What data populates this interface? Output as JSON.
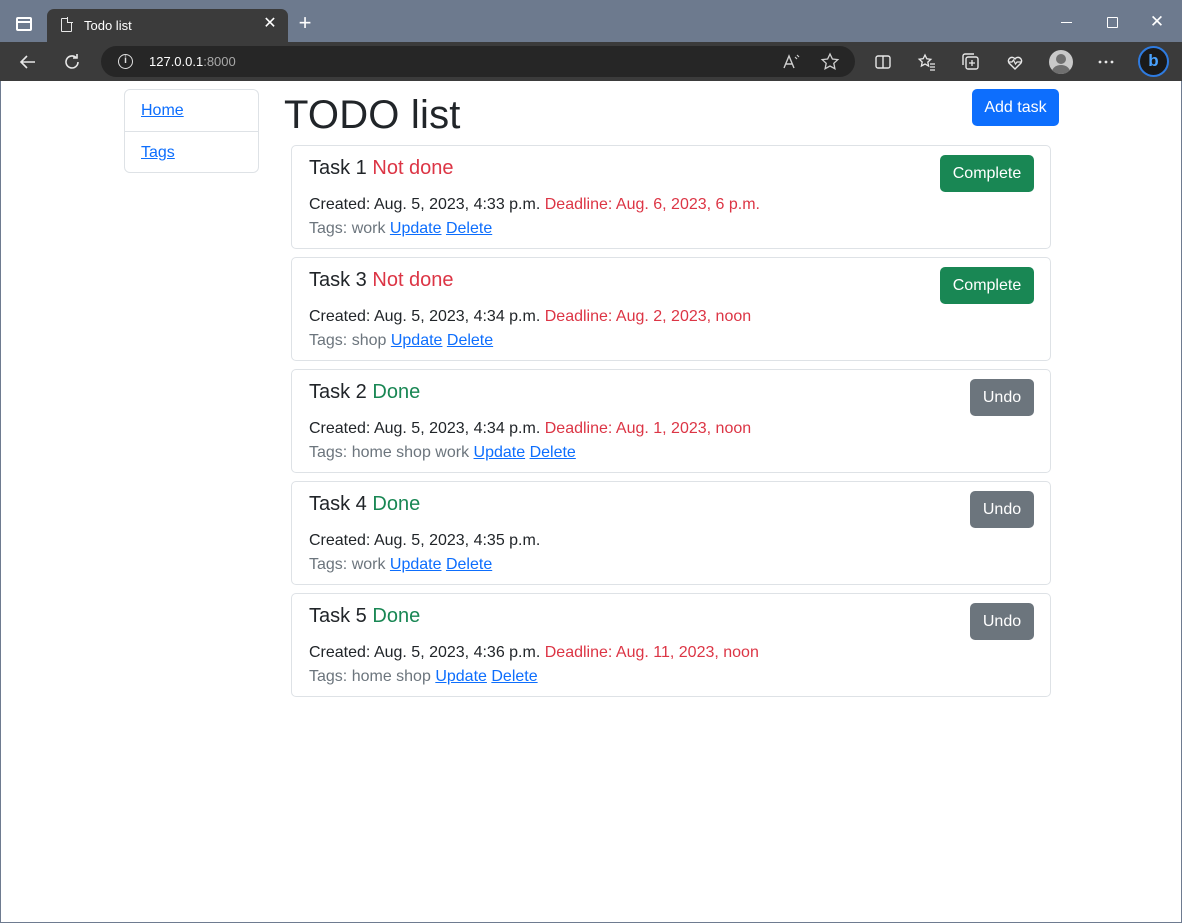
{
  "browser": {
    "tab_title": "Todo list",
    "tab_close": "✕",
    "new_tab": "+",
    "url_host": "127.0.0.1",
    "url_port": ":8000",
    "win_close": "✕"
  },
  "nav": {
    "items": [
      {
        "label": "Home"
      },
      {
        "label": "Tags"
      }
    ]
  },
  "page": {
    "title": "TODO list",
    "add_button": "Add task"
  },
  "labels": {
    "created_prefix": "Created: ",
    "deadline_prefix": "Deadline: ",
    "tags_prefix": "Tags: ",
    "update": "Update",
    "delete": "Delete"
  },
  "tasks": [
    {
      "name": "Task 1",
      "status": "Not done",
      "done": false,
      "created": "Aug. 5, 2023, 4:33 p.m.",
      "deadline": "Aug. 6, 2023, 6 p.m.",
      "tags": "work",
      "action": "Complete"
    },
    {
      "name": "Task 3",
      "status": "Not done",
      "done": false,
      "created": "Aug. 5, 2023, 4:34 p.m.",
      "deadline": "Aug. 2, 2023, noon",
      "tags": "shop",
      "action": "Complete"
    },
    {
      "name": "Task 2",
      "status": "Done",
      "done": true,
      "created": "Aug. 5, 2023, 4:34 p.m.",
      "deadline": "Aug. 1, 2023, noon",
      "tags": "home shop work",
      "action": "Undo"
    },
    {
      "name": "Task 4",
      "status": "Done",
      "done": true,
      "created": "Aug. 5, 2023, 4:35 p.m.",
      "deadline": "",
      "tags": "work",
      "action": "Undo"
    },
    {
      "name": "Task 5",
      "status": "Done",
      "done": true,
      "created": "Aug. 5, 2023, 4:36 p.m.",
      "deadline": "Aug. 11, 2023, noon",
      "tags": "home shop",
      "action": "Undo"
    }
  ],
  "colors": {
    "primary": "#0d6efd",
    "success": "#198754",
    "danger": "#dc3545",
    "secondary": "#6c757d"
  }
}
